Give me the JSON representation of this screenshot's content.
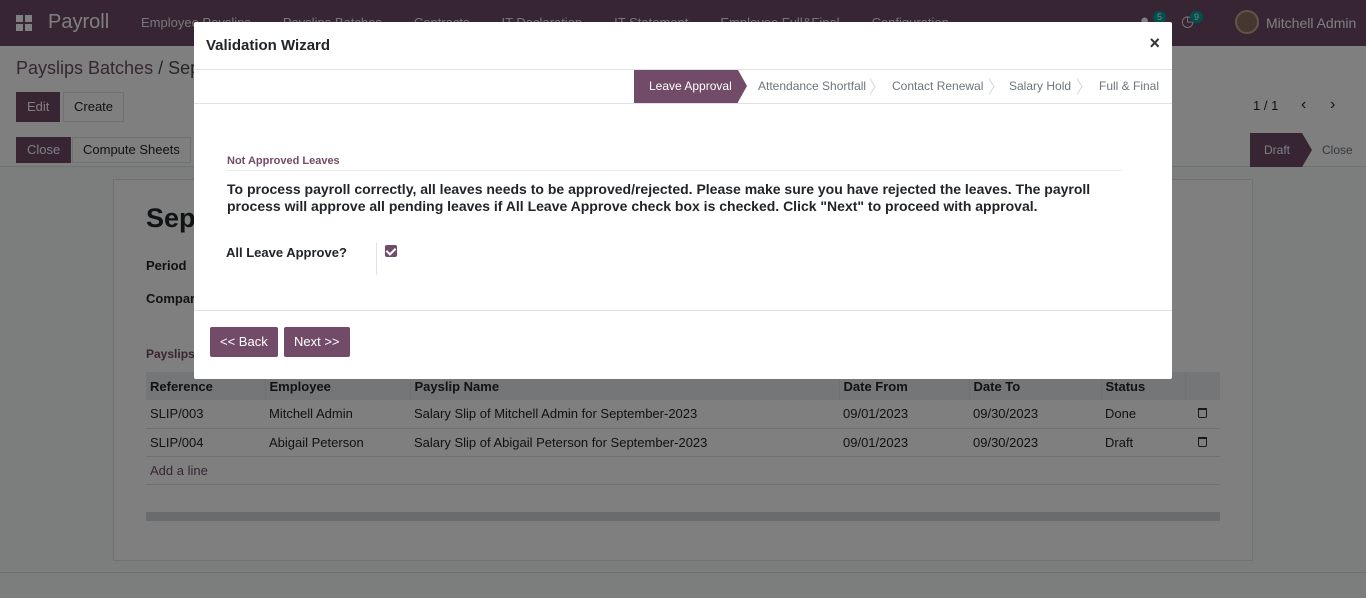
{
  "navbar": {
    "brand": "Payroll",
    "menu": [
      "Employee Payslips",
      "Payslips Batches",
      "Contracts",
      "IT Declaration",
      "IT Statement",
      "Employee Full&Final",
      "Configuration"
    ],
    "messages_count": "5",
    "activities_count": "9",
    "user": "Mitchell Admin"
  },
  "breadcrumb": {
    "parent": "Payslips Batches",
    "separator": " / ",
    "current": "Sep"
  },
  "buttons": {
    "edit": "Edit",
    "create": "Create",
    "close": "Close",
    "compute_sheets": "Compute Sheets"
  },
  "pager": {
    "value": "1 / 1"
  },
  "statusbar": {
    "active": "Draft",
    "next": "Close"
  },
  "sheet": {
    "title": "Sep",
    "period_label": "Period",
    "company_label": "Compar",
    "tab_label": "Payslips",
    "columns": [
      "Reference",
      "Employee",
      "Payslip Name",
      "Date From",
      "Date To",
      "Status"
    ],
    "rows": [
      {
        "reference": "SLIP/003",
        "employee": "Mitchell Admin",
        "name": "Salary Slip of Mitchell Admin for September-2023",
        "date_from": "09/01/2023",
        "date_to": "09/30/2023",
        "status": "Done"
      },
      {
        "reference": "SLIP/004",
        "employee": "Abigail Peterson",
        "name": "Salary Slip of Abigail Peterson for September-2023",
        "date_from": "09/01/2023",
        "date_to": "09/30/2023",
        "status": "Draft"
      }
    ],
    "add_line": "Add a line"
  },
  "modal": {
    "title": "Validation Wizard",
    "close": "×",
    "steps": [
      "Leave Approval",
      "Attendance Shortfall",
      "Contact Renewal",
      "Salary Hold",
      "Full & Final"
    ],
    "section_title": "Not Approved Leaves",
    "message": "To process payroll correctly, all leaves needs to be approved/rejected. Please make sure you have rejected the leaves. The payroll process will approve all pending leaves if All Leave Approve check box is checked. Click \"Next\" to proceed with approval.",
    "field_label": "All Leave Approve?",
    "field_checked": true,
    "back_button": "<< Back",
    "next_button": "Next >>"
  },
  "colors": {
    "primary": "#714b67",
    "badge": "#00a09d"
  }
}
